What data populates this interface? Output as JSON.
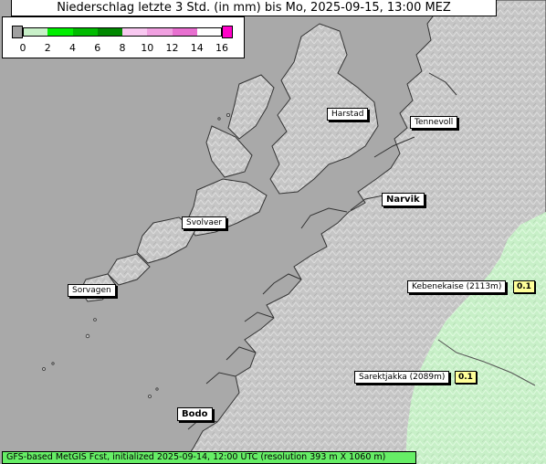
{
  "title": "Niederschlag letzte 3 Std. (in mm) bis Mo, 2025-09-15, 13:00 MEZ",
  "legend": {
    "ticks": [
      "0",
      "2",
      "4",
      "6",
      "8",
      "10",
      "12",
      "14",
      "16"
    ],
    "colors": [
      "#a0a0a0",
      "#c8f0c8",
      "#00ee00",
      "#00bb00",
      "#008800",
      "#f8c8f0",
      "#f0a0e0",
      "#e870d0",
      "#ff00c8"
    ]
  },
  "cities": [
    {
      "name": "Harstad",
      "bold": false
    },
    {
      "name": "Tennevoll",
      "bold": false
    },
    {
      "name": "Narvik",
      "bold": true
    },
    {
      "name": "Svolvaer",
      "bold": false
    },
    {
      "name": "Sorvagen",
      "bold": false
    },
    {
      "name": "Kebenekaise (2113m)",
      "bold": false,
      "value": "0.1"
    },
    {
      "name": "Sarektjakka (2089m)",
      "bold": false,
      "value": "0.1"
    },
    {
      "name": "Bodo",
      "bold": true
    }
  ],
  "colors": {
    "sea": "#a9a9a9",
    "land": "#c4c4c4",
    "precip_light": "#c8f0c8",
    "footer": "#66ee66",
    "value_box": "#ffff99"
  },
  "footer": "GFS-based MetGIS Fcst, initialized 2025-09-14, 12:00 UTC  (resolution 393 m X 1060 m)"
}
